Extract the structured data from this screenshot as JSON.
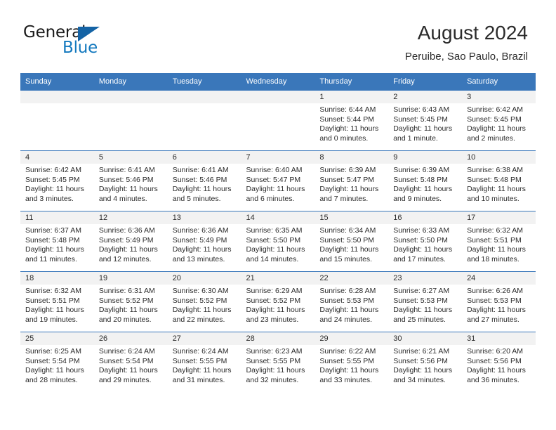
{
  "logo": {
    "word_one": "General",
    "word_two": "Blue",
    "triangle_color": "#1463a5",
    "blue_color": "#1278be"
  },
  "header": {
    "title": "August 2024",
    "subtitle": "Peruibe, Sao Paulo, Brazil"
  },
  "theme": {
    "header_blue": "#3a77ba",
    "date_band": "#f2f2f2",
    "text": "#2b2b2b"
  },
  "calendar": {
    "weekday_headers": [
      "Sunday",
      "Monday",
      "Tuesday",
      "Wednesday",
      "Thursday",
      "Friday",
      "Saturday"
    ],
    "weeks": [
      [
        {
          "date": "",
          "sunrise": "",
          "sunset": "",
          "daylight_1": "",
          "daylight_2": ""
        },
        {
          "date": "",
          "sunrise": "",
          "sunset": "",
          "daylight_1": "",
          "daylight_2": ""
        },
        {
          "date": "",
          "sunrise": "",
          "sunset": "",
          "daylight_1": "",
          "daylight_2": ""
        },
        {
          "date": "",
          "sunrise": "",
          "sunset": "",
          "daylight_1": "",
          "daylight_2": ""
        },
        {
          "date": "1",
          "sunrise": "Sunrise: 6:44 AM",
          "sunset": "Sunset: 5:44 PM",
          "daylight_1": "Daylight: 11 hours",
          "daylight_2": "and 0 minutes."
        },
        {
          "date": "2",
          "sunrise": "Sunrise: 6:43 AM",
          "sunset": "Sunset: 5:45 PM",
          "daylight_1": "Daylight: 11 hours",
          "daylight_2": "and 1 minute."
        },
        {
          "date": "3",
          "sunrise": "Sunrise: 6:42 AM",
          "sunset": "Sunset: 5:45 PM",
          "daylight_1": "Daylight: 11 hours",
          "daylight_2": "and 2 minutes."
        }
      ],
      [
        {
          "date": "4",
          "sunrise": "Sunrise: 6:42 AM",
          "sunset": "Sunset: 5:45 PM",
          "daylight_1": "Daylight: 11 hours",
          "daylight_2": "and 3 minutes."
        },
        {
          "date": "5",
          "sunrise": "Sunrise: 6:41 AM",
          "sunset": "Sunset: 5:46 PM",
          "daylight_1": "Daylight: 11 hours",
          "daylight_2": "and 4 minutes."
        },
        {
          "date": "6",
          "sunrise": "Sunrise: 6:41 AM",
          "sunset": "Sunset: 5:46 PM",
          "daylight_1": "Daylight: 11 hours",
          "daylight_2": "and 5 minutes."
        },
        {
          "date": "7",
          "sunrise": "Sunrise: 6:40 AM",
          "sunset": "Sunset: 5:47 PM",
          "daylight_1": "Daylight: 11 hours",
          "daylight_2": "and 6 minutes."
        },
        {
          "date": "8",
          "sunrise": "Sunrise: 6:39 AM",
          "sunset": "Sunset: 5:47 PM",
          "daylight_1": "Daylight: 11 hours",
          "daylight_2": "and 7 minutes."
        },
        {
          "date": "9",
          "sunrise": "Sunrise: 6:39 AM",
          "sunset": "Sunset: 5:48 PM",
          "daylight_1": "Daylight: 11 hours",
          "daylight_2": "and 9 minutes."
        },
        {
          "date": "10",
          "sunrise": "Sunrise: 6:38 AM",
          "sunset": "Sunset: 5:48 PM",
          "daylight_1": "Daylight: 11 hours",
          "daylight_2": "and 10 minutes."
        }
      ],
      [
        {
          "date": "11",
          "sunrise": "Sunrise: 6:37 AM",
          "sunset": "Sunset: 5:48 PM",
          "daylight_1": "Daylight: 11 hours",
          "daylight_2": "and 11 minutes."
        },
        {
          "date": "12",
          "sunrise": "Sunrise: 6:36 AM",
          "sunset": "Sunset: 5:49 PM",
          "daylight_1": "Daylight: 11 hours",
          "daylight_2": "and 12 minutes."
        },
        {
          "date": "13",
          "sunrise": "Sunrise: 6:36 AM",
          "sunset": "Sunset: 5:49 PM",
          "daylight_1": "Daylight: 11 hours",
          "daylight_2": "and 13 minutes."
        },
        {
          "date": "14",
          "sunrise": "Sunrise: 6:35 AM",
          "sunset": "Sunset: 5:50 PM",
          "daylight_1": "Daylight: 11 hours",
          "daylight_2": "and 14 minutes."
        },
        {
          "date": "15",
          "sunrise": "Sunrise: 6:34 AM",
          "sunset": "Sunset: 5:50 PM",
          "daylight_1": "Daylight: 11 hours",
          "daylight_2": "and 15 minutes."
        },
        {
          "date": "16",
          "sunrise": "Sunrise: 6:33 AM",
          "sunset": "Sunset: 5:50 PM",
          "daylight_1": "Daylight: 11 hours",
          "daylight_2": "and 17 minutes."
        },
        {
          "date": "17",
          "sunrise": "Sunrise: 6:32 AM",
          "sunset": "Sunset: 5:51 PM",
          "daylight_1": "Daylight: 11 hours",
          "daylight_2": "and 18 minutes."
        }
      ],
      [
        {
          "date": "18",
          "sunrise": "Sunrise: 6:32 AM",
          "sunset": "Sunset: 5:51 PM",
          "daylight_1": "Daylight: 11 hours",
          "daylight_2": "and 19 minutes."
        },
        {
          "date": "19",
          "sunrise": "Sunrise: 6:31 AM",
          "sunset": "Sunset: 5:52 PM",
          "daylight_1": "Daylight: 11 hours",
          "daylight_2": "and 20 minutes."
        },
        {
          "date": "20",
          "sunrise": "Sunrise: 6:30 AM",
          "sunset": "Sunset: 5:52 PM",
          "daylight_1": "Daylight: 11 hours",
          "daylight_2": "and 22 minutes."
        },
        {
          "date": "21",
          "sunrise": "Sunrise: 6:29 AM",
          "sunset": "Sunset: 5:52 PM",
          "daylight_1": "Daylight: 11 hours",
          "daylight_2": "and 23 minutes."
        },
        {
          "date": "22",
          "sunrise": "Sunrise: 6:28 AM",
          "sunset": "Sunset: 5:53 PM",
          "daylight_1": "Daylight: 11 hours",
          "daylight_2": "and 24 minutes."
        },
        {
          "date": "23",
          "sunrise": "Sunrise: 6:27 AM",
          "sunset": "Sunset: 5:53 PM",
          "daylight_1": "Daylight: 11 hours",
          "daylight_2": "and 25 minutes."
        },
        {
          "date": "24",
          "sunrise": "Sunrise: 6:26 AM",
          "sunset": "Sunset: 5:53 PM",
          "daylight_1": "Daylight: 11 hours",
          "daylight_2": "and 27 minutes."
        }
      ],
      [
        {
          "date": "25",
          "sunrise": "Sunrise: 6:25 AM",
          "sunset": "Sunset: 5:54 PM",
          "daylight_1": "Daylight: 11 hours",
          "daylight_2": "and 28 minutes."
        },
        {
          "date": "26",
          "sunrise": "Sunrise: 6:24 AM",
          "sunset": "Sunset: 5:54 PM",
          "daylight_1": "Daylight: 11 hours",
          "daylight_2": "and 29 minutes."
        },
        {
          "date": "27",
          "sunrise": "Sunrise: 6:24 AM",
          "sunset": "Sunset: 5:55 PM",
          "daylight_1": "Daylight: 11 hours",
          "daylight_2": "and 31 minutes."
        },
        {
          "date": "28",
          "sunrise": "Sunrise: 6:23 AM",
          "sunset": "Sunset: 5:55 PM",
          "daylight_1": "Daylight: 11 hours",
          "daylight_2": "and 32 minutes."
        },
        {
          "date": "29",
          "sunrise": "Sunrise: 6:22 AM",
          "sunset": "Sunset: 5:55 PM",
          "daylight_1": "Daylight: 11 hours",
          "daylight_2": "and 33 minutes."
        },
        {
          "date": "30",
          "sunrise": "Sunrise: 6:21 AM",
          "sunset": "Sunset: 5:56 PM",
          "daylight_1": "Daylight: 11 hours",
          "daylight_2": "and 34 minutes."
        },
        {
          "date": "31",
          "sunrise": "Sunrise: 6:20 AM",
          "sunset": "Sunset: 5:56 PM",
          "daylight_1": "Daylight: 11 hours",
          "daylight_2": "and 36 minutes."
        }
      ]
    ]
  }
}
